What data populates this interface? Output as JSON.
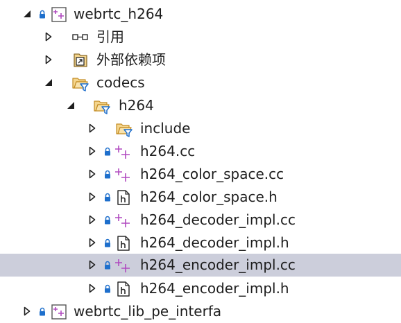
{
  "solution_explorer": {
    "project": {
      "label": "webrtc_h264"
    },
    "references": {
      "label": "引用"
    },
    "external_deps": {
      "label": "外部依赖项"
    },
    "codecs_folder": {
      "label": "codecs"
    },
    "h264_folder": {
      "label": "h264"
    },
    "include_folder": {
      "label": "include"
    },
    "files": [
      {
        "label": "h264.cc",
        "type": "cpp"
      },
      {
        "label": "h264_color_space.cc",
        "type": "cpp"
      },
      {
        "label": "h264_color_space.h",
        "type": "header"
      },
      {
        "label": "h264_decoder_impl.cc",
        "type": "cpp"
      },
      {
        "label": "h264_decoder_impl.h",
        "type": "header"
      },
      {
        "label": "h264_encoder_impl.cc",
        "type": "cpp",
        "selected": true
      },
      {
        "label": "h264_encoder_impl.h",
        "type": "header"
      }
    ],
    "next_project_partial": {
      "label": "webrtc_lib_pe_interfa"
    }
  },
  "colors": {
    "selection": "#cccedb",
    "lock": "#1e6fcc",
    "cpp_plus": "#b04ac0",
    "folder": "#d9a441",
    "filter": "#1e6fcc"
  }
}
